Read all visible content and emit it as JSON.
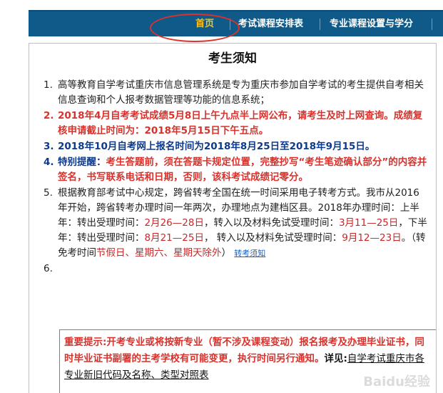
{
  "nav": {
    "home": "首页",
    "exam_schedule": "考试课程安排表",
    "major_courses": "专业课程设置与学分"
  },
  "notice": {
    "title": "考生须知",
    "items": [
      {
        "num": "1.",
        "text": "高等教育自学考试重庆市信息管理系统是专为重庆市参加自学考试的考生提供自考相关信息查询和个人报考数据管理等功能的信息系统；"
      },
      {
        "num": "2.",
        "text": "2018年4月自考考试成绩5月8日上午九点半上网公布，请考生及时上网查询。成绩复核申请截止时间为：2018年5月15日下午五点。"
      },
      {
        "num": "3.",
        "text": "2018年10月自考网上报名时间为2018年8月25日至2018年9月15日。"
      },
      {
        "num": "4.",
        "label": "特别提醒：",
        "text": "考生答题前，须在答题卡规定位置，完整抄写“考生笔迹确认部分”的内容并签名，书写联系电话和日期，否则，该科考试成绩记零分。"
      },
      {
        "num": "5.",
        "p1": "根据教育部考试中心规定，跨省转考全国在统一时间采用电子转考方式。我市从2016年开始，跨省转考办理时间一年两次，办理地点为建档区县。2018年办理时间：上半年：转出受理时间：",
        "d1": "2月26—28日",
        "p2": "，转入以及材料免试受理时间：",
        "d2": "3月11—25日",
        "p3": "，下半年：转出受理时间：",
        "d3": "8月21—25日",
        "p4": "， 转入以及材料免试受理时间：",
        "d4": "9月12—23日",
        "p5": "。（转免考时间",
        "d5": "节假日、星期六、星期天除外",
        "p6": "）",
        "link": "转考须知"
      },
      {
        "num": "6."
      }
    ],
    "important": {
      "text": "重要提示:开考专业或将按新专业（暂不涉及课程变动）报名报考及办理毕业证书，同时毕业证书副署的主考学校有可能变更，执行时间另行通知。",
      "detail_label": "详见:",
      "detail_link": "自学考试重庆市各专业新旧代码及名称、类型对照表"
    }
  },
  "watermark": "Baidu经验"
}
